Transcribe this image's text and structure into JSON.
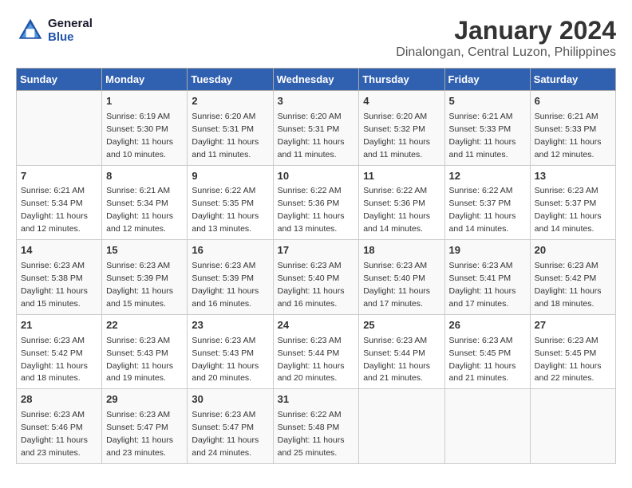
{
  "header": {
    "logo_line1": "General",
    "logo_line2": "Blue",
    "title": "January 2024",
    "subtitle": "Dinalongan, Central Luzon, Philippines"
  },
  "days_of_week": [
    "Sunday",
    "Monday",
    "Tuesday",
    "Wednesday",
    "Thursday",
    "Friday",
    "Saturday"
  ],
  "weeks": [
    [
      {
        "day": "",
        "sunrise": "",
        "sunset": "",
        "daylight": ""
      },
      {
        "day": "1",
        "sunrise": "Sunrise: 6:19 AM",
        "sunset": "Sunset: 5:30 PM",
        "daylight": "Daylight: 11 hours and 10 minutes."
      },
      {
        "day": "2",
        "sunrise": "Sunrise: 6:20 AM",
        "sunset": "Sunset: 5:31 PM",
        "daylight": "Daylight: 11 hours and 11 minutes."
      },
      {
        "day": "3",
        "sunrise": "Sunrise: 6:20 AM",
        "sunset": "Sunset: 5:31 PM",
        "daylight": "Daylight: 11 hours and 11 minutes."
      },
      {
        "day": "4",
        "sunrise": "Sunrise: 6:20 AM",
        "sunset": "Sunset: 5:32 PM",
        "daylight": "Daylight: 11 hours and 11 minutes."
      },
      {
        "day": "5",
        "sunrise": "Sunrise: 6:21 AM",
        "sunset": "Sunset: 5:33 PM",
        "daylight": "Daylight: 11 hours and 11 minutes."
      },
      {
        "day": "6",
        "sunrise": "Sunrise: 6:21 AM",
        "sunset": "Sunset: 5:33 PM",
        "daylight": "Daylight: 11 hours and 12 minutes."
      }
    ],
    [
      {
        "day": "7",
        "sunrise": "Sunrise: 6:21 AM",
        "sunset": "Sunset: 5:34 PM",
        "daylight": "Daylight: 11 hours and 12 minutes."
      },
      {
        "day": "8",
        "sunrise": "Sunrise: 6:21 AM",
        "sunset": "Sunset: 5:34 PM",
        "daylight": "Daylight: 11 hours and 12 minutes."
      },
      {
        "day": "9",
        "sunrise": "Sunrise: 6:22 AM",
        "sunset": "Sunset: 5:35 PM",
        "daylight": "Daylight: 11 hours and 13 minutes."
      },
      {
        "day": "10",
        "sunrise": "Sunrise: 6:22 AM",
        "sunset": "Sunset: 5:36 PM",
        "daylight": "Daylight: 11 hours and 13 minutes."
      },
      {
        "day": "11",
        "sunrise": "Sunrise: 6:22 AM",
        "sunset": "Sunset: 5:36 PM",
        "daylight": "Daylight: 11 hours and 14 minutes."
      },
      {
        "day": "12",
        "sunrise": "Sunrise: 6:22 AM",
        "sunset": "Sunset: 5:37 PM",
        "daylight": "Daylight: 11 hours and 14 minutes."
      },
      {
        "day": "13",
        "sunrise": "Sunrise: 6:23 AM",
        "sunset": "Sunset: 5:37 PM",
        "daylight": "Daylight: 11 hours and 14 minutes."
      }
    ],
    [
      {
        "day": "14",
        "sunrise": "Sunrise: 6:23 AM",
        "sunset": "Sunset: 5:38 PM",
        "daylight": "Daylight: 11 hours and 15 minutes."
      },
      {
        "day": "15",
        "sunrise": "Sunrise: 6:23 AM",
        "sunset": "Sunset: 5:39 PM",
        "daylight": "Daylight: 11 hours and 15 minutes."
      },
      {
        "day": "16",
        "sunrise": "Sunrise: 6:23 AM",
        "sunset": "Sunset: 5:39 PM",
        "daylight": "Daylight: 11 hours and 16 minutes."
      },
      {
        "day": "17",
        "sunrise": "Sunrise: 6:23 AM",
        "sunset": "Sunset: 5:40 PM",
        "daylight": "Daylight: 11 hours and 16 minutes."
      },
      {
        "day": "18",
        "sunrise": "Sunrise: 6:23 AM",
        "sunset": "Sunset: 5:40 PM",
        "daylight": "Daylight: 11 hours and 17 minutes."
      },
      {
        "day": "19",
        "sunrise": "Sunrise: 6:23 AM",
        "sunset": "Sunset: 5:41 PM",
        "daylight": "Daylight: 11 hours and 17 minutes."
      },
      {
        "day": "20",
        "sunrise": "Sunrise: 6:23 AM",
        "sunset": "Sunset: 5:42 PM",
        "daylight": "Daylight: 11 hours and 18 minutes."
      }
    ],
    [
      {
        "day": "21",
        "sunrise": "Sunrise: 6:23 AM",
        "sunset": "Sunset: 5:42 PM",
        "daylight": "Daylight: 11 hours and 18 minutes."
      },
      {
        "day": "22",
        "sunrise": "Sunrise: 6:23 AM",
        "sunset": "Sunset: 5:43 PM",
        "daylight": "Daylight: 11 hours and 19 minutes."
      },
      {
        "day": "23",
        "sunrise": "Sunrise: 6:23 AM",
        "sunset": "Sunset: 5:43 PM",
        "daylight": "Daylight: 11 hours and 20 minutes."
      },
      {
        "day": "24",
        "sunrise": "Sunrise: 6:23 AM",
        "sunset": "Sunset: 5:44 PM",
        "daylight": "Daylight: 11 hours and 20 minutes."
      },
      {
        "day": "25",
        "sunrise": "Sunrise: 6:23 AM",
        "sunset": "Sunset: 5:44 PM",
        "daylight": "Daylight: 11 hours and 21 minutes."
      },
      {
        "day": "26",
        "sunrise": "Sunrise: 6:23 AM",
        "sunset": "Sunset: 5:45 PM",
        "daylight": "Daylight: 11 hours and 21 minutes."
      },
      {
        "day": "27",
        "sunrise": "Sunrise: 6:23 AM",
        "sunset": "Sunset: 5:45 PM",
        "daylight": "Daylight: 11 hours and 22 minutes."
      }
    ],
    [
      {
        "day": "28",
        "sunrise": "Sunrise: 6:23 AM",
        "sunset": "Sunset: 5:46 PM",
        "daylight": "Daylight: 11 hours and 23 minutes."
      },
      {
        "day": "29",
        "sunrise": "Sunrise: 6:23 AM",
        "sunset": "Sunset: 5:47 PM",
        "daylight": "Daylight: 11 hours and 23 minutes."
      },
      {
        "day": "30",
        "sunrise": "Sunrise: 6:23 AM",
        "sunset": "Sunset: 5:47 PM",
        "daylight": "Daylight: 11 hours and 24 minutes."
      },
      {
        "day": "31",
        "sunrise": "Sunrise: 6:22 AM",
        "sunset": "Sunset: 5:48 PM",
        "daylight": "Daylight: 11 hours and 25 minutes."
      },
      {
        "day": "",
        "sunrise": "",
        "sunset": "",
        "daylight": ""
      },
      {
        "day": "",
        "sunrise": "",
        "sunset": "",
        "daylight": ""
      },
      {
        "day": "",
        "sunrise": "",
        "sunset": "",
        "daylight": ""
      }
    ]
  ]
}
